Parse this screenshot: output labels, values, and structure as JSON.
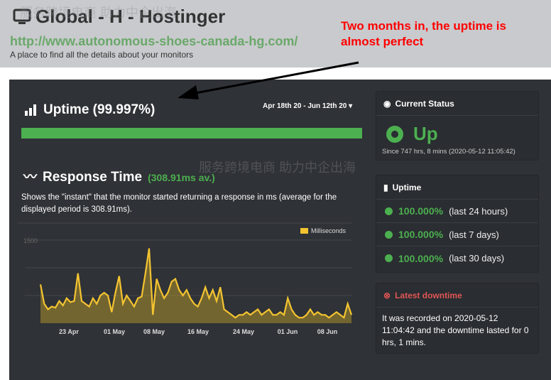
{
  "header": {
    "title": "Global - H - Hostinger",
    "url": "http://www.autonomous-shoes-canada-hg.com/",
    "tagline": "A place to find all the details about your monitors"
  },
  "annotation": {
    "line1": "Two months in, the uptime is",
    "line2": "almost perfect"
  },
  "uptime": {
    "title": "Uptime (99.997%)",
    "range": "Apr 18th 20 - Jun 12th 20",
    "percent": 99.997
  },
  "response": {
    "title": "Response Time",
    "avg": "(308.91ms av.)",
    "description": "Shows the \"instant\" that the monitor started returning a response in ms (average for the displayed period is 308.91ms)."
  },
  "current_status": {
    "title": "Current Status",
    "status": "Up",
    "since": "Since 747 hrs, 8 mins (2020-05-12 11:05:42)"
  },
  "uptime_box": {
    "title": "Uptime",
    "rows": [
      {
        "pct": "100.000%",
        "period": "(last 24 hours)"
      },
      {
        "pct": "100.000%",
        "period": "(last 7 days)"
      },
      {
        "pct": "100.000%",
        "period": "(last 30 days)"
      }
    ]
  },
  "downtime": {
    "title": "Latest downtime",
    "text": "It was recorded on 2020-05-12 11:04:42 and the downtime lasted for 0 hrs, 1 mins."
  },
  "watermark": {
    "a": "服务跨境电商 助力中企出海"
  },
  "chart_data": {
    "type": "area",
    "title": "Response Time",
    "legend": [
      "Milliseconds"
    ],
    "color": "#f4c430",
    "ylim": [
      0,
      1500
    ],
    "yticks": [
      1500
    ],
    "xticks": [
      "23 Apr",
      "01 May",
      "08 May",
      "16 May",
      "24 May",
      "01 Jun",
      "08 Jun"
    ],
    "values": [
      700,
      350,
      250,
      300,
      280,
      400,
      320,
      450,
      380,
      400,
      900,
      400,
      350,
      300,
      450,
      350,
      500,
      550,
      500,
      200,
      550,
      850,
      350,
      500,
      400,
      300,
      450,
      480,
      900,
      1350,
      150,
      800,
      600,
      450,
      550,
      750,
      800,
      600,
      500,
      600,
      450,
      350,
      300,
      450,
      650,
      450,
      600,
      400,
      650,
      250,
      200,
      150,
      100,
      150,
      150,
      200,
      150,
      200,
      250,
      150,
      200,
      250,
      150,
      150,
      200,
      150,
      450,
      250,
      150,
      100,
      100,
      150,
      250,
      150,
      200,
      150,
      150,
      100,
      150,
      200,
      150,
      100,
      350,
      150
    ]
  }
}
